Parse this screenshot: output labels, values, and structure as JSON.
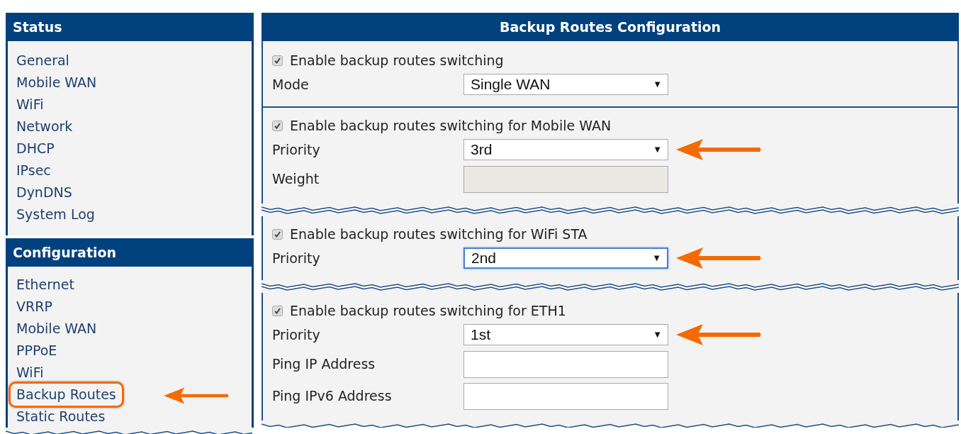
{
  "sidebar": {
    "sections": [
      {
        "title": "Status",
        "items": [
          {
            "label": "General",
            "annotated": false
          },
          {
            "label": "Mobile WAN",
            "annotated": false
          },
          {
            "label": "WiFi",
            "annotated": false
          },
          {
            "label": "Network",
            "annotated": false
          },
          {
            "label": "DHCP",
            "annotated": false
          },
          {
            "label": "IPsec",
            "annotated": false
          },
          {
            "label": "DynDNS",
            "annotated": false
          },
          {
            "label": "System Log",
            "annotated": false
          }
        ]
      },
      {
        "title": "Configuration",
        "items": [
          {
            "label": "Ethernet",
            "annotated": false
          },
          {
            "label": "VRRP",
            "annotated": false
          },
          {
            "label": "Mobile WAN",
            "annotated": false
          },
          {
            "label": "PPPoE",
            "annotated": false
          },
          {
            "label": "WiFi",
            "annotated": false
          },
          {
            "label": "Backup Routes",
            "annotated": true
          },
          {
            "label": "Static Routes",
            "annotated": false
          }
        ]
      }
    ]
  },
  "main": {
    "title": "Backup Routes Configuration",
    "sections": [
      {
        "torn_after": false,
        "rows": [
          {
            "kind": "checkbox",
            "label": "Enable backup routes switching",
            "checked": true
          },
          {
            "kind": "select",
            "label": "Mode",
            "value": "Single WAN",
            "caret": "▼",
            "focused": false,
            "annotated": false
          }
        ]
      },
      {
        "torn_after": true,
        "rows": [
          {
            "kind": "checkbox",
            "label": "Enable backup routes switching for Mobile WAN",
            "checked": true
          },
          {
            "kind": "select",
            "label": "Priority",
            "value": "3rd",
            "caret": "▼",
            "focused": false,
            "annotated": true
          },
          {
            "kind": "text",
            "label": "Weight",
            "disabled": true
          }
        ]
      },
      {
        "torn_after": true,
        "rows": [
          {
            "kind": "checkbox",
            "label": "Enable backup routes switching for WiFi STA",
            "checked": true
          },
          {
            "kind": "select",
            "label": "Priority",
            "value": "2nd",
            "caret": "▼",
            "focused": true,
            "annotated": true
          }
        ]
      },
      {
        "torn_after": true,
        "rows": [
          {
            "kind": "checkbox",
            "label": "Enable backup routes switching for ETH1",
            "checked": true
          },
          {
            "kind": "select",
            "label": "Priority",
            "value": "1st",
            "caret": "▼",
            "focused": false,
            "annotated": true
          },
          {
            "kind": "text",
            "label": "Ping IP Address",
            "disabled": false
          },
          {
            "kind": "text",
            "label": "Ping IPv6 Address",
            "disabled": false
          }
        ]
      }
    ]
  }
}
